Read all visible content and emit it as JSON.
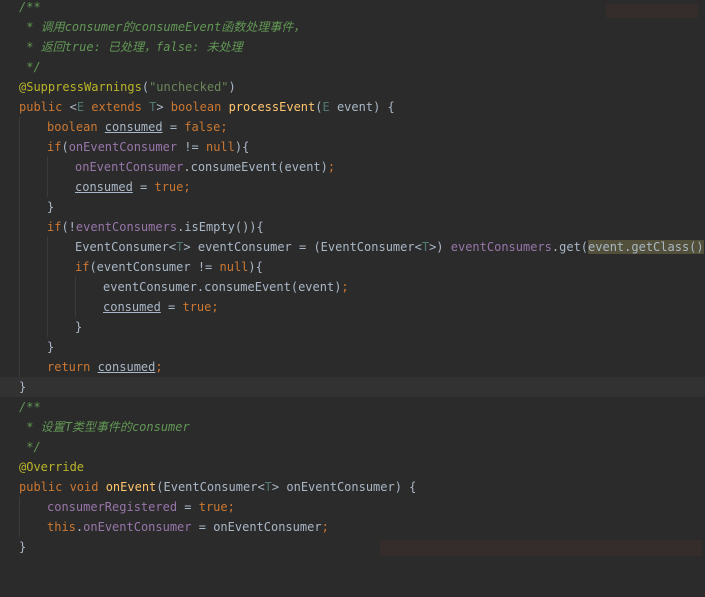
{
  "code": {
    "l1": "/**",
    "l2_a": " * 调用",
    "l2_b": "consumer",
    "l2_c": "的",
    "l2_d": "consumeEvent",
    "l2_e": "函数处理事件，",
    "l3_a": " * 返回",
    "l3_b": "true",
    "l3_c": ": 已处理，",
    "l3_d": "false",
    "l3_e": ": 未处理",
    "l4": " */",
    "l5_ann": "@SuppressWarnings",
    "l5_p1": "(",
    "l5_str": "\"unchecked\"",
    "l5_p2": ")",
    "l6_kw1": "public ",
    "l6_lt": "<",
    "l6_E": "E",
    "l6_ext": " extends ",
    "l6_T": "T",
    "l6_gt": "> ",
    "l6_bool": "boolean ",
    "l6_fn": "processEvent",
    "l6_p": "(",
    "l6_E2": "E",
    "l6_rest": " event) {",
    "l7_kw": "boolean ",
    "l7_var": "consumed",
    "l7_eq": " = ",
    "l7_false": "false",
    "l7_semi": ";",
    "l8_if": "if",
    "l8_p": "(",
    "l8_fld": "onEventConsumer",
    "l8_ne": " != ",
    "l8_null": "null",
    "l8_end": "){",
    "l9_fld": "onEventConsumer",
    "l9_call": ".consumeEvent(event)",
    "l9_semi": ";",
    "l10_var": "consumed",
    "l10_eq": " = ",
    "l10_true": "true",
    "l10_semi": ";",
    "l11": "}",
    "l12_if": "if",
    "l12_p": "(!",
    "l12_fld": "eventConsumers",
    "l12_rest": ".isEmpty()){",
    "l13_a": "EventConsumer",
    "l13_lt": "<",
    "l13_T": "T",
    "l13_gt": ">",
    "l13_b": " eventConsumer = (EventConsumer",
    "l13_lt2": "<",
    "l13_T2": "T",
    "l13_gt2": ">",
    "l13_c": ") ",
    "l13_fld": "eventConsumers",
    "l13_d": ".get(",
    "l13_hl": "event.getClass()",
    "l13_e": ")",
    "l13_semi": ";",
    "l14_if": "if",
    "l14_rest": "(eventConsumer != ",
    "l14_null": "null",
    "l14_end": "){",
    "l15_call": "eventConsumer.consumeEvent(event)",
    "l15_semi": ";",
    "l16_var": "consumed",
    "l16_eq": " = ",
    "l16_true": "true",
    "l16_semi": ";",
    "l17": "}",
    "l18": "}",
    "l19_ret": "return ",
    "l19_var": "consumed",
    "l19_semi": ";",
    "l20": "}",
    "l21": "/**",
    "l22_a": " * 设置",
    "l22_b": "T",
    "l22_c": "类型事件的",
    "l22_d": "consumer",
    "l23": " */",
    "l24": "@Override",
    "l25_kw": "public void ",
    "l25_fn": "onEvent",
    "l25_p": "(EventConsumer",
    "l25_lt": "<",
    "l25_T": "T",
    "l25_gt": ">",
    "l25_rest": " onEventConsumer) {",
    "l26_fld": "consumerRegistered",
    "l26_eq": " = ",
    "l26_true": "true",
    "l26_semi": ";",
    "l27_this": "this",
    "l27_dot": ".",
    "l27_fld": "onEventConsumer",
    "l27_rest": " = onEventConsumer",
    "l27_semi": ";",
    "l28": "}"
  },
  "colors": {
    "background": "#2b2b2b",
    "keyword": "#cc7832",
    "annotation": "#bbb529",
    "string": "#6a8759",
    "doc_comment": "#629755",
    "field": "#9876aa",
    "method_decl": "#ffc66d",
    "type_param": "#507874",
    "default_text": "#a9b7c6"
  }
}
